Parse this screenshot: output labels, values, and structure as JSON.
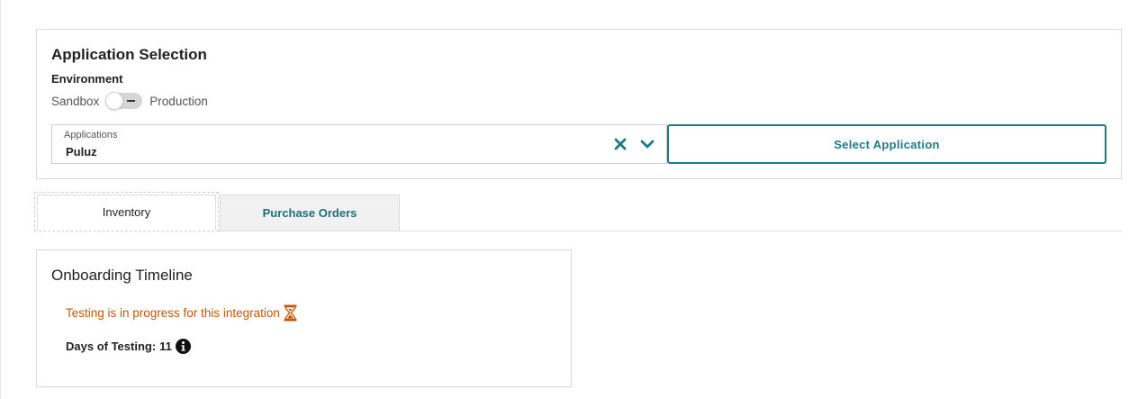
{
  "app_selection": {
    "title": "Application Selection",
    "environment_label": "Environment",
    "toggle_left_label": "Sandbox",
    "toggle_right_label": "Production",
    "applications_field": {
      "label": "Applications",
      "value": "Puluz"
    },
    "select_button_label": "Select Application"
  },
  "tabs": [
    {
      "label": "Inventory",
      "active": true
    },
    {
      "label": "Purchase Orders",
      "active": false
    }
  ],
  "onboarding": {
    "title": "Onboarding Timeline",
    "status_text": "Testing is in progress for this integration",
    "days_label": "Days of Testing:",
    "days_value": "11"
  },
  "icons": {
    "clear": "close-icon",
    "dropdown": "chevron-down-icon",
    "status": "hourglass-icon",
    "info": "info-icon"
  },
  "colors": {
    "accent": "#1d7a86",
    "status_orange": "#c2570c"
  }
}
